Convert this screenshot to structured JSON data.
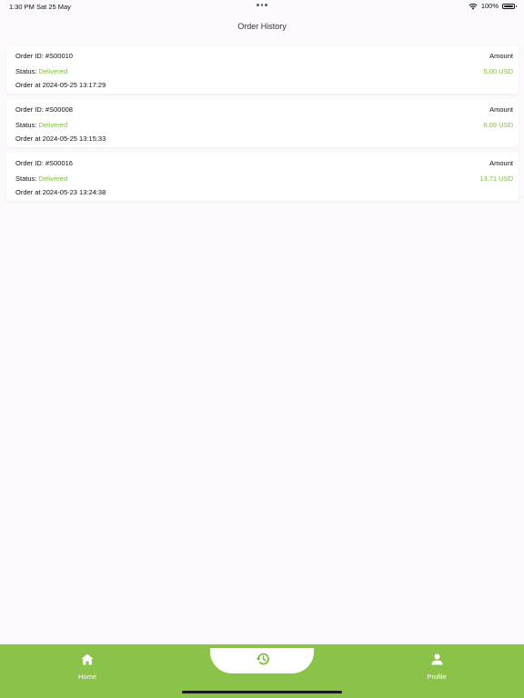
{
  "status_bar": {
    "time": "1:30 PM",
    "date": "Sat 25 May",
    "battery": "100%"
  },
  "header": {
    "title": "Order History"
  },
  "orders": [
    {
      "id_text": "Order ID: #S00010",
      "amount_label": "Amount",
      "status_label": "Status:",
      "status_value": "Delivered",
      "amount_value": "5.00 USD",
      "date_text": "Order at 2024-05-25 13:17:29"
    },
    {
      "id_text": "Order ID: #S00008",
      "amount_label": "Amount",
      "status_label": "Status:",
      "status_value": "Delivered",
      "amount_value": "6.09 USD",
      "date_text": "Order at 2024-05-25 13:15:33"
    },
    {
      "id_text": "Order ID: #S00016",
      "amount_label": "Amount",
      "status_label": "Status:",
      "status_value": "Delivered",
      "amount_value": "13.71 USD",
      "date_text": "Order at 2024-05-23 13:24:38"
    }
  ],
  "bottom_nav": {
    "home_label": "Home",
    "profile_label": "Profile",
    "active_icon": "history-icon"
  },
  "colors": {
    "accent": "#8bc34a",
    "status_green": "#7bbe3a",
    "background": "#fcf9fd"
  }
}
